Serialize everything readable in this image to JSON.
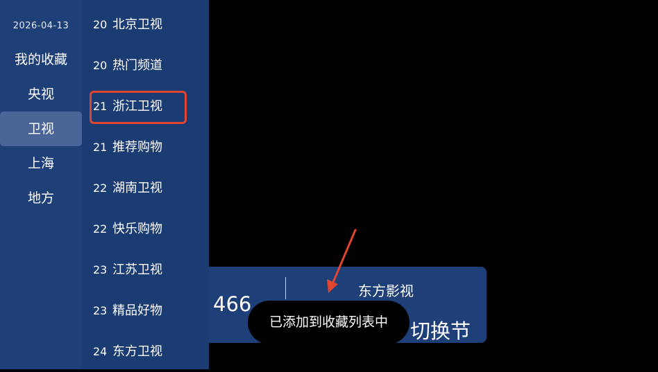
{
  "date": "2026-04-13",
  "categories": [
    {
      "label": "我的收藏",
      "active": false
    },
    {
      "label": "央视",
      "active": false
    },
    {
      "label": "卫视",
      "active": true
    },
    {
      "label": "上海",
      "active": false
    },
    {
      "label": "地方",
      "active": false
    }
  ],
  "channels": [
    {
      "number": "20",
      "name": "北京卫视"
    },
    {
      "number": "20",
      "name": "热门频道"
    },
    {
      "number": "21",
      "name": "浙江卫视"
    },
    {
      "number": "21",
      "name": "推荐购物"
    },
    {
      "number": "22",
      "name": "湖南卫视"
    },
    {
      "number": "22",
      "name": "快乐购物"
    },
    {
      "number": "23",
      "name": "江苏卫视"
    },
    {
      "number": "23",
      "name": "精品好物"
    },
    {
      "number": "24",
      "name": "东方卫视"
    }
  ],
  "info_bar": {
    "number_partial": "466",
    "channel_name": "东方影视",
    "hint_partial": "切换节"
  },
  "toast": {
    "message": "已添加到收藏列表中"
  },
  "colors": {
    "panel": "#1f3f78",
    "channel_panel": "#1b3b73",
    "active": "#4b6598",
    "highlight": "#e0452f"
  }
}
